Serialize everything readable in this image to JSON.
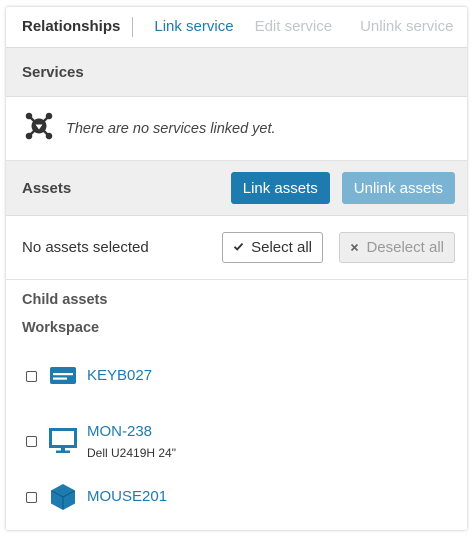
{
  "header": {
    "title": "Relationships",
    "tabs": [
      {
        "label": "Link service",
        "state": "active"
      },
      {
        "label": "Edit service",
        "state": "disabled"
      },
      {
        "label": "Unlink service",
        "state": "disabled"
      }
    ]
  },
  "services": {
    "label": "Services",
    "empty_message": "There are no services linked yet.",
    "empty_icon": "no-services-icon"
  },
  "assets": {
    "label": "Assets",
    "link_label": "Link assets",
    "unlink_label": "Unlink assets",
    "selection_status": "No assets selected",
    "select_all_label": "Select all",
    "deselect_all_label": "Deselect all"
  },
  "child_assets": {
    "title": "Child assets",
    "group": "Workspace",
    "items": [
      {
        "name": "KEYB027",
        "subtitle": "",
        "icon": "keyboard-icon",
        "checked": false
      },
      {
        "name": "MON-238",
        "subtitle": "Dell U2419H 24\"",
        "icon": "monitor-icon",
        "checked": false
      },
      {
        "name": "MOUSE201",
        "subtitle": "",
        "icon": "cube-icon",
        "checked": false
      }
    ]
  },
  "colors": {
    "accent": "#1e7bb0",
    "accent_disabled": "#7ab4d2",
    "section_bg": "#efefef",
    "disabled_text": "#c2c6ca"
  }
}
